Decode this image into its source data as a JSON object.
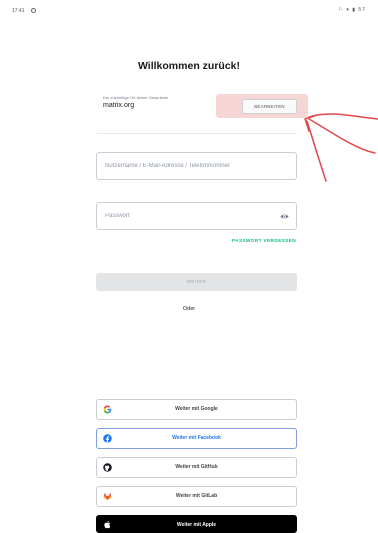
{
  "status_bar": {
    "time": "17:41",
    "icons": "⚐ ▾ ▮ 57"
  },
  "title": "Willkommen zurück!",
  "server": {
    "caption": "Der zukünftige Ort deiner Gespräche",
    "name": "matrix.org",
    "edit_label": "BEARBEITEN"
  },
  "login": {
    "username_placeholder": "Nutzername / E-Mail-Adresse / Telefonnummer",
    "password_placeholder": "Passwort",
    "forgot_label": "PASSWORT VERGESSEN",
    "continue_label": "WEITER",
    "or_label": "Oder"
  },
  "sso": {
    "google": "Weiter mit Google",
    "facebook": "Weiter mit Facebook",
    "github": "Weiter mit GitHub",
    "gitlab": "Weiter mit GitLab",
    "apple": "Weiter mit Apple"
  },
  "colors": {
    "accent": "#0dbd8b",
    "facebook": "#1877f2",
    "annotation": "#e0484c"
  }
}
